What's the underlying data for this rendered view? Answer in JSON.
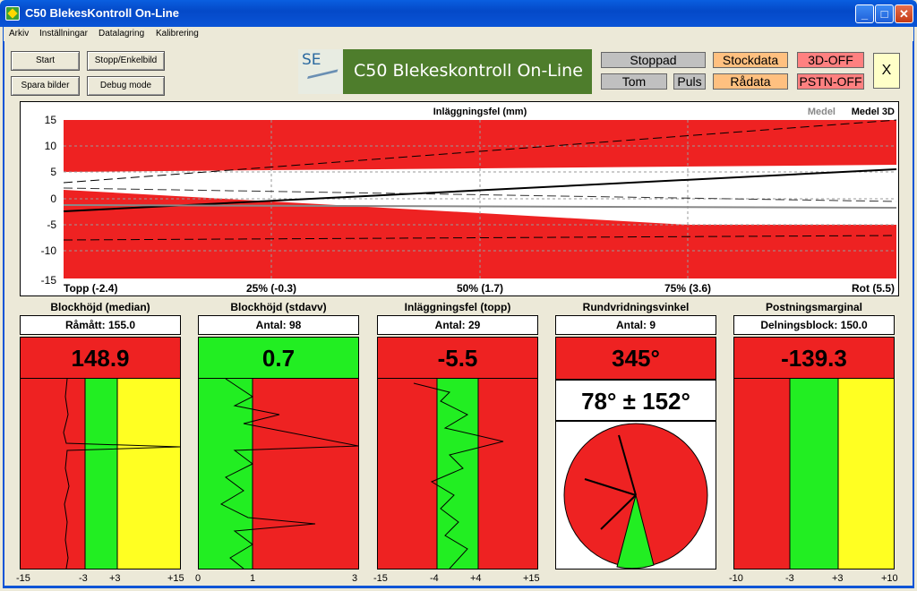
{
  "window": {
    "title": "C50 BlekesKontroll On-Line",
    "min": "_",
    "max": "□",
    "close": "✕"
  },
  "menu": [
    "Arkiv",
    "Inställningar",
    "Datalagring",
    "Kalibrering"
  ],
  "buttons": {
    "start": "Start",
    "stop": "Stopp/Enkelbild",
    "save": "Spara bilder",
    "debug": "Debug mode"
  },
  "logo": {
    "se": "SE",
    "text": "C50  Blekeskontroll On-Line"
  },
  "status": {
    "stoppad": "Stoppad",
    "tom": "Tom",
    "puls": "Puls",
    "stockdata": "Stockdata",
    "radata": "Rådata",
    "off3d": "3D-OFF",
    "pstn": "PSTN-OFF",
    "exit": "X"
  },
  "colors": {
    "red": "#ee2222",
    "green": "#22ee22",
    "yellow": "#ffff22",
    "grey": "#c0c0c0",
    "orange": "#ffc080",
    "pink": "#ff8080"
  },
  "chart": {
    "title": "Inläggningsfel (mm)",
    "legend_model": "Medel",
    "legend_model3d": "Medel 3D",
    "y_ticks": [
      "15",
      "10",
      "5",
      "0",
      "-5",
      "-10",
      "-15"
    ],
    "x_labels": [
      "Topp (-2.4)",
      "25% (-0.3)",
      "50% (1.7)",
      "75% (3.6)",
      "Rot (5.5)"
    ]
  },
  "panels": [
    {
      "title": "Blockhöjd (median)",
      "sub": "Råmått: 155.0",
      "value": "148.9",
      "axis": [
        "-15",
        "-3",
        "+3",
        "+15"
      ]
    },
    {
      "title": "Blockhöjd (stdavv)",
      "sub": "Antal: 98",
      "value": "0.7",
      "axis": [
        "0",
        "1",
        "3"
      ]
    },
    {
      "title": "Inläggningsfel (topp)",
      "sub": "Antal: 29",
      "value": "-5.5",
      "axis": [
        "-15",
        "-4",
        "+4",
        "+15"
      ]
    },
    {
      "title": "Rundvridningsvinkel",
      "sub": "Antal: 9",
      "value": "345°",
      "extra": "78° ± 152°"
    },
    {
      "title": "Postningsmarginal",
      "sub": "Delningsblock: 150.0",
      "value": "-139.3",
      "axis": [
        "-10",
        "-3",
        "+3",
        "+10"
      ]
    }
  ]
}
